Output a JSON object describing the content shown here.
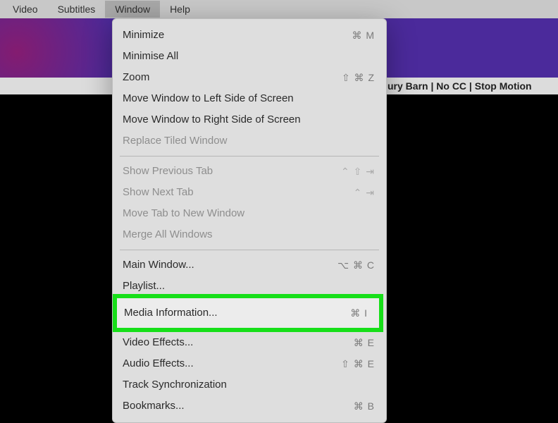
{
  "menubar": {
    "video": "Video",
    "subtitles": "Subtitles",
    "window": "Window",
    "help": "Help"
  },
  "title_fragment": "ury Barn | No CC | Stop Motion ",
  "dropdown": {
    "minimize": {
      "label": "Minimize",
      "shortcut": "⌘ M"
    },
    "minimise_all": {
      "label": "Minimise All",
      "shortcut": ""
    },
    "zoom": {
      "label": "Zoom",
      "shortcut": "⇧ ⌘ Z"
    },
    "move_left": {
      "label": "Move Window to Left Side of Screen",
      "shortcut": ""
    },
    "move_right": {
      "label": "Move Window to Right Side of Screen",
      "shortcut": ""
    },
    "replace_tiled": {
      "label": "Replace Tiled Window",
      "shortcut": ""
    },
    "show_prev_tab": {
      "label": "Show Previous Tab",
      "shortcut": "⌃ ⇧ ⇥"
    },
    "show_next_tab": {
      "label": "Show Next Tab",
      "shortcut": "⌃ ⇥"
    },
    "move_tab_new": {
      "label": "Move Tab to New Window",
      "shortcut": ""
    },
    "merge_windows": {
      "label": "Merge All Windows",
      "shortcut": ""
    },
    "main_window": {
      "label": "Main Window...",
      "shortcut": "⌥ ⌘ C"
    },
    "playlist": {
      "label": "Playlist...",
      "shortcut": ""
    },
    "media_info": {
      "label": "Media Information...",
      "shortcut": "⌘ I"
    },
    "video_effects": {
      "label": "Video Effects...",
      "shortcut": "⌘ E"
    },
    "audio_effects": {
      "label": "Audio Effects...",
      "shortcut": "⇧ ⌘ E"
    },
    "track_sync": {
      "label": "Track Synchronization",
      "shortcut": ""
    },
    "bookmarks": {
      "label": "Bookmarks...",
      "shortcut": "⌘ B"
    }
  }
}
